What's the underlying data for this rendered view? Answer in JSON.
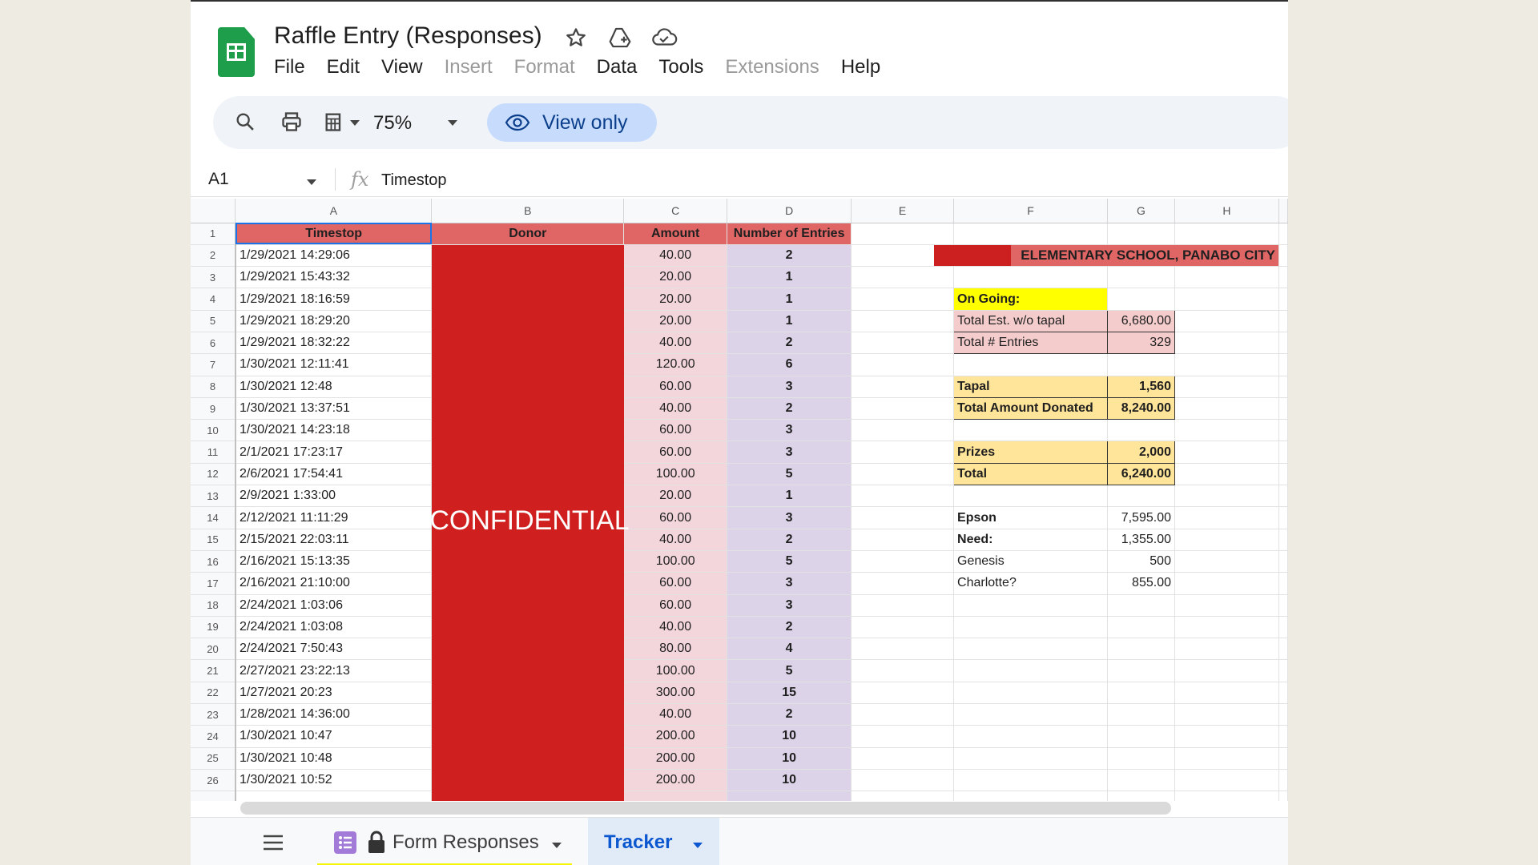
{
  "app": {
    "doc_title": "Raffle Entry (Responses)",
    "menu": [
      "File",
      "Edit",
      "View",
      "Insert",
      "Format",
      "Data",
      "Tools",
      "Extensions",
      "Help"
    ],
    "menu_disabled": [
      "Insert",
      "Format",
      "Extensions"
    ]
  },
  "toolbar": {
    "zoom": "75%",
    "view_only": "View only"
  },
  "formula_bar": {
    "cell_ref": "A1",
    "fx": "fx",
    "value": "Timestop"
  },
  "columns": [
    "A",
    "B",
    "C",
    "D",
    "E",
    "F",
    "G",
    "H"
  ],
  "headers": {
    "timestop": "Timestop",
    "donor": "Donor",
    "amount": "Amount",
    "entries": "Number of Entries"
  },
  "rows": [
    {
      "num": "2",
      "ts": "1/29/2021 14:29:06",
      "amt": "40.00",
      "ent": "2"
    },
    {
      "num": "3",
      "ts": "1/29/2021 15:43:32",
      "amt": "20.00",
      "ent": "1"
    },
    {
      "num": "4",
      "ts": "1/29/2021 18:16:59",
      "amt": "20.00",
      "ent": "1"
    },
    {
      "num": "5",
      "ts": "1/29/2021 18:29:20",
      "amt": "20.00",
      "ent": "1"
    },
    {
      "num": "6",
      "ts": "1/29/2021 18:32:22",
      "amt": "40.00",
      "ent": "2"
    },
    {
      "num": "7",
      "ts": "1/30/2021 12:11:41",
      "amt": "120.00",
      "ent": "6"
    },
    {
      "num": "8",
      "ts": "1/30/2021 12:48",
      "amt": "60.00",
      "ent": "3"
    },
    {
      "num": "9",
      "ts": "1/30/2021 13:37:51",
      "amt": "40.00",
      "ent": "2"
    },
    {
      "num": "10",
      "ts": "1/30/2021 14:23:18",
      "amt": "60.00",
      "ent": "3"
    },
    {
      "num": "11",
      "ts": "2/1/2021 17:23:17",
      "amt": "60.00",
      "ent": "3"
    },
    {
      "num": "12",
      "ts": "2/6/2021 17:54:41",
      "amt": "100.00",
      "ent": "5"
    },
    {
      "num": "13",
      "ts": "2/9/2021 1:33:00",
      "amt": "20.00",
      "ent": "1"
    },
    {
      "num": "14",
      "ts": "2/12/2021 11:11:29",
      "amt": "60.00",
      "ent": "3"
    },
    {
      "num": "15",
      "ts": "2/15/2021 22:03:11",
      "amt": "40.00",
      "ent": "2"
    },
    {
      "num": "16",
      "ts": "2/16/2021 15:13:35",
      "amt": "100.00",
      "ent": "5"
    },
    {
      "num": "17",
      "ts": "2/16/2021 21:10:00",
      "amt": "60.00",
      "ent": "3"
    },
    {
      "num": "18",
      "ts": "2/24/2021 1:03:06",
      "amt": "60.00",
      "ent": "3"
    },
    {
      "num": "19",
      "ts": "2/24/2021 1:03:08",
      "amt": "40.00",
      "ent": "2"
    },
    {
      "num": "20",
      "ts": "2/24/2021 7:50:43",
      "amt": "80.00",
      "ent": "4"
    },
    {
      "num": "21",
      "ts": "2/27/2021 23:22:13",
      "amt": "100.00",
      "ent": "5"
    },
    {
      "num": "22",
      "ts": "1/27/2021 20:23",
      "amt": "300.00",
      "ent": "15"
    },
    {
      "num": "23",
      "ts": "1/28/2021 14:36:00",
      "amt": "40.00",
      "ent": "2"
    },
    {
      "num": "24",
      "ts": "1/30/2021 10:47",
      "amt": "200.00",
      "ent": "10"
    },
    {
      "num": "25",
      "ts": "1/30/2021 10:48",
      "amt": "200.00",
      "ent": "10"
    },
    {
      "num": "26",
      "ts": "1/30/2021 10:52",
      "amt": "200.00",
      "ent": "10"
    }
  ],
  "right_panel": {
    "school": "ELEMENTARY SCHOOL, PANABO CITY",
    "on_going": "On Going:",
    "total_est_label": "Total Est. w/o tapal",
    "total_est": "6,680.00",
    "total_entries_label": "Total # Entries",
    "total_entries": "329",
    "tapal_label": "Tapal",
    "tapal": "1,560",
    "total_donated_label": "Total Amount Donated",
    "total_donated": "8,240.00",
    "prizes_label": "Prizes",
    "prizes": "2,000",
    "total_label": "Total",
    "total": "6,240.00",
    "epson_label": "Epson",
    "epson": "7,595.00",
    "need_label": "Need:",
    "need": "1,355.00",
    "genesis_label": "Genesis",
    "genesis": "500",
    "charlotte_label": "Charlotte?",
    "charlotte": "855.00"
  },
  "overlay": {
    "confidential": "CONFIDENTIAL"
  },
  "tabs": {
    "form_responses": "Form Responses",
    "tracker": "Tracker"
  },
  "colors": {
    "header_red": "#e06666",
    "redaction": "#cf1f1f",
    "amount_bg": "#f3d6db",
    "entries_bg": "#ddd3e8",
    "yellow": "#ffff00",
    "gold": "#ffe599",
    "pink": "#f4cccc",
    "view_only_bg": "#c7dcfc"
  }
}
